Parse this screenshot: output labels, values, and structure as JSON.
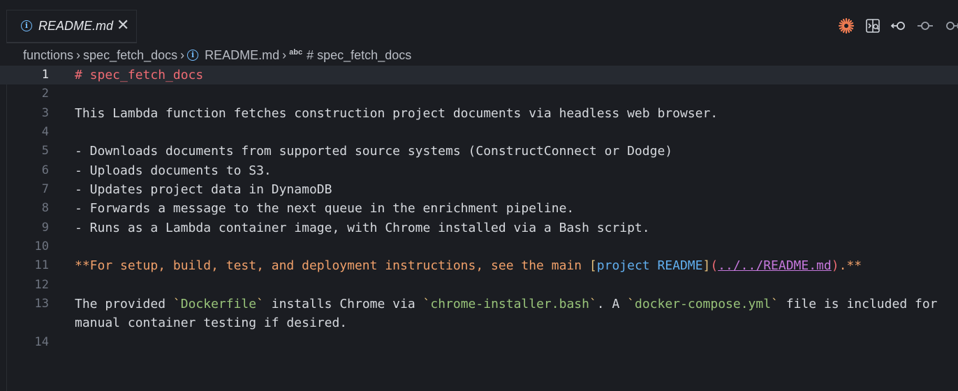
{
  "tab": {
    "title": "README.md",
    "close": "✕"
  },
  "breadcrumb": {
    "items": [
      "functions",
      "spec_fetch_docs",
      "README.md",
      "# spec_fetch_docs"
    ],
    "abc": "abc",
    "sep": "›"
  },
  "actions": [
    "chat-sparkle-icon",
    "open-preview-to-side-icon",
    "go-back-icon",
    "previous-change-icon",
    "next-change-icon"
  ],
  "editor": {
    "lines": [
      {
        "n": "1",
        "segments": [
          {
            "t": "# spec_fetch_docs",
            "c": "h1"
          }
        ]
      },
      {
        "n": "2",
        "segments": []
      },
      {
        "n": "3",
        "segments": [
          {
            "t": "This Lambda function fetches construction project documents via headless web browser.",
            "c": ""
          }
        ]
      },
      {
        "n": "4",
        "segments": []
      },
      {
        "n": "5",
        "segments": [
          {
            "t": "- Downloads documents from supported source systems (ConstructConnect or Dodge)",
            "c": ""
          }
        ]
      },
      {
        "n": "6",
        "segments": [
          {
            "t": "- Uploads documents to S3.",
            "c": ""
          }
        ]
      },
      {
        "n": "7",
        "segments": [
          {
            "t": "- Updates project data in DynamoDB",
            "c": ""
          }
        ]
      },
      {
        "n": "8",
        "segments": [
          {
            "t": "- Forwards a message to the next queue in the enrichment pipeline.",
            "c": ""
          }
        ]
      },
      {
        "n": "9",
        "segments": [
          {
            "t": "- Runs as a Lambda container image, with Chrome installed via a Bash script.",
            "c": ""
          }
        ]
      },
      {
        "n": "10",
        "segments": []
      },
      {
        "n": "11",
        "segments": [
          {
            "t": "**For setup, build, test, and deployment instructions, see the main ",
            "c": "bold"
          },
          {
            "t": "[",
            "c": "bracket"
          },
          {
            "t": "project README",
            "c": "linktext"
          },
          {
            "t": "]",
            "c": "bracket"
          },
          {
            "t": "(",
            "c": "paren"
          },
          {
            "t": "../../README.md",
            "c": "url"
          },
          {
            "t": ")",
            "c": "paren"
          },
          {
            "t": ".**",
            "c": "bold"
          }
        ]
      },
      {
        "n": "12",
        "segments": []
      },
      {
        "n": "13",
        "tall": true,
        "segments": [
          {
            "t": "The provided ",
            "c": ""
          },
          {
            "t": "`",
            "c": "tick"
          },
          {
            "t": "Dockerfile",
            "c": "inline"
          },
          {
            "t": "`",
            "c": "tick"
          },
          {
            "t": " installs Chrome via ",
            "c": ""
          },
          {
            "t": "`",
            "c": "tick"
          },
          {
            "t": "chrome-installer.bash",
            "c": "inline"
          },
          {
            "t": "`",
            "c": "tick"
          },
          {
            "t": ". A ",
            "c": ""
          },
          {
            "t": "`",
            "c": "tick"
          },
          {
            "t": "docker-compose.yml",
            "c": "inline"
          },
          {
            "t": "`",
            "c": "tick"
          },
          {
            "t": " file is included for manual container testing if desired.",
            "c": ""
          }
        ]
      },
      {
        "n": "14",
        "segments": []
      }
    ]
  },
  "colors": {
    "background": "#1b1d22",
    "heading": "#ef6b73",
    "bold": "#f0a06a",
    "link": "#61afef",
    "url": "#c678dd",
    "inline_code": "#98c379",
    "info": "#75beff",
    "sparkle": "#f07c52"
  }
}
